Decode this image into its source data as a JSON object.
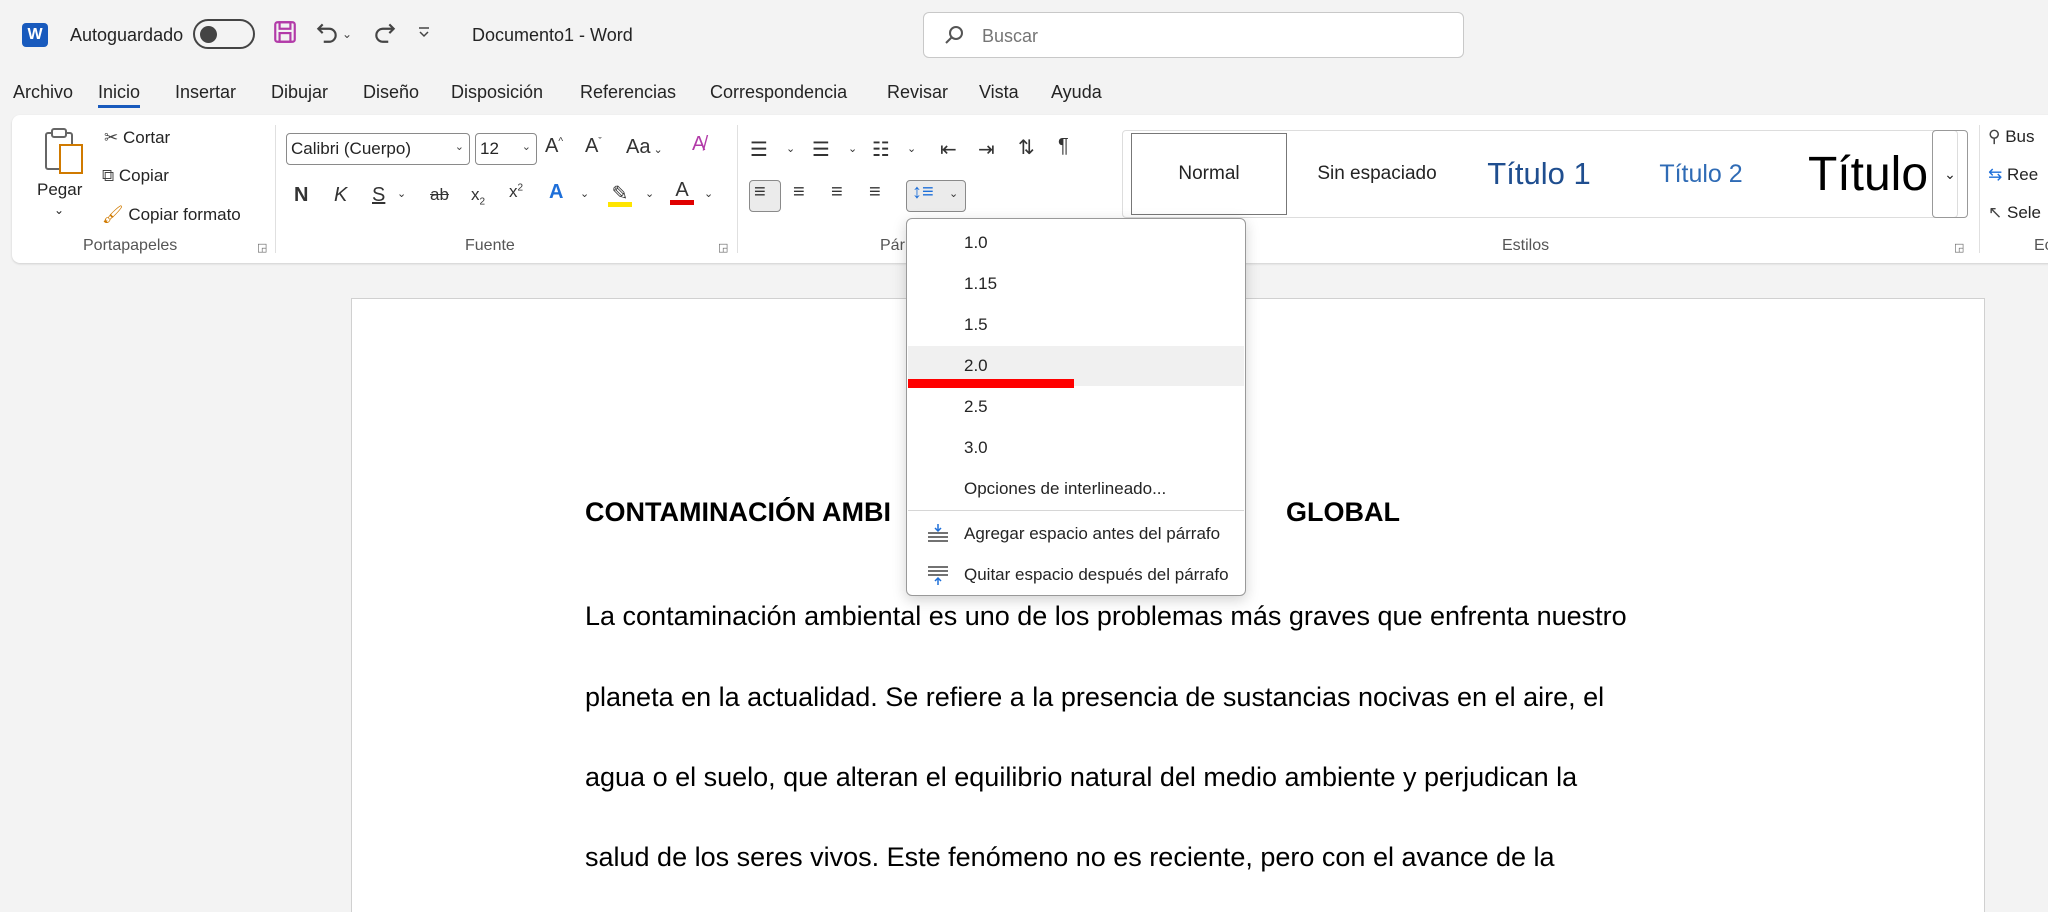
{
  "titlebar": {
    "app_logo": "W",
    "autosave_label": "Autoguardado",
    "doc_title": "Documento1  -  Word",
    "search_placeholder": "Buscar",
    "icons": [
      "word-logo-icon",
      "save-icon",
      "undo-icon",
      "redo-icon",
      "customize-toolbar-icon",
      "search-icon"
    ]
  },
  "tabs": [
    "Archivo",
    "Inicio",
    "Insertar",
    "Dibujar",
    "Diseño",
    "Disposición",
    "Referencias",
    "Correspondencia",
    "Revisar",
    "Vista",
    "Ayuda"
  ],
  "active_tab": "Inicio",
  "ribbon": {
    "clipboard": {
      "paste": "Pegar",
      "cut": "Cortar",
      "copy": "Copiar",
      "format_painter": "Copiar formato",
      "group": "Portapapeles"
    },
    "font": {
      "font_name": "Calibri (Cuerpo)",
      "font_size": "12",
      "bold": "N",
      "italic": "K",
      "underline": "S",
      "strike": "ab",
      "change_case": "Aa",
      "group": "Fuente"
    },
    "paragraph": {
      "group": "Pár"
    },
    "styles": {
      "items": [
        "Normal",
        "Sin espaciado",
        "Título 1",
        "Título 2",
        "Título"
      ],
      "group": "Estilos"
    },
    "editing": {
      "find": "Bus",
      "replace": "Ree",
      "select": "Sele",
      "group": "Ec"
    }
  },
  "line_spacing_menu": {
    "options": [
      "1.0",
      "1.15",
      "1.5",
      "2.0",
      "2.5",
      "3.0"
    ],
    "highlighted": "2.0",
    "more_options": "Opciones de interlineado...",
    "add_before": "Agregar espacio antes del párrafo",
    "remove_after": "Quitar espacio después del párrafo"
  },
  "document": {
    "heading_left": "CONTAMINACIÓN  AMBI",
    "heading_right": "GLOBAL",
    "lines": [
      "La contaminación ambiental es uno de los problemas más graves que enfrenta  nuestro",
      "planeta en la actualidad. Se refiere a la presencia de sustancias nocivas en el aire, el",
      "agua o el suelo, que alteran el equilibrio natural del medio ambiente y perjudican la",
      "salud de los seres vivos. Este fenómeno no es reciente,  pero con el avance de la"
    ]
  },
  "colors": {
    "accent": "#185abd",
    "highlight": "#ffe500",
    "font_color": "#e00000",
    "annotation": "#ff0000"
  }
}
